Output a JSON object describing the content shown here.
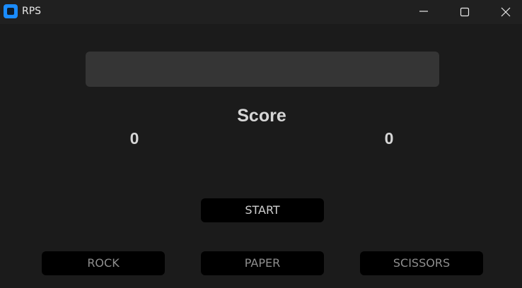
{
  "window": {
    "title": "RPS",
    "icon": "app-icon",
    "controls": [
      "minimize-icon",
      "maximize-icon",
      "close-icon"
    ]
  },
  "display": {
    "text": ""
  },
  "score": {
    "label": "Score",
    "player": "0",
    "computer": "0"
  },
  "buttons": {
    "start": "START",
    "rock": "ROCK",
    "paper": "PAPER",
    "scissors": "SCISSORS"
  },
  "colors": {
    "background": "#1b1b1b",
    "titlebar": "#202020",
    "display": "#353535",
    "button": "#000000",
    "accent": "#1a8cff"
  }
}
